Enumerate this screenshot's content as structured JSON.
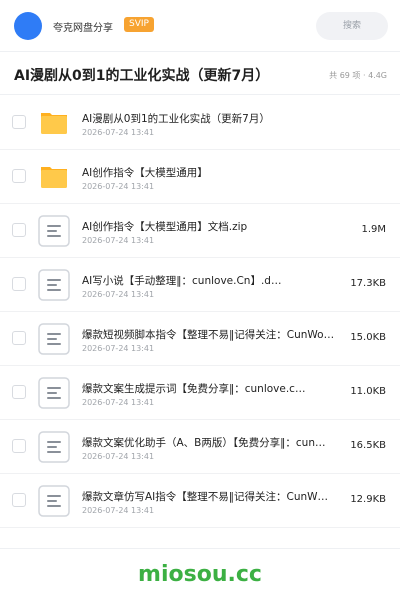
{
  "header": {
    "user_name": "夸克网盘分享",
    "badge": "SVIP",
    "search_placeholder": "搜索"
  },
  "folder": {
    "title": "AI漫剧从0到1的工业化实战（更新7月）",
    "meta": "共 69 项 · 4.4G"
  },
  "files": [
    {
      "type": "folder",
      "icon": "folder-icon",
      "name": "AI漫剧从0到1的工业化实战（更新7月）",
      "date": "2026-07-24 13:41",
      "size": ""
    },
    {
      "type": "folder",
      "icon": "folder-icon",
      "name": "AI创作指令【大模型通用】",
      "date": "2026-07-24 13:41",
      "size": ""
    },
    {
      "type": "file",
      "icon": "document-icon",
      "name": "AI创作指令【大模型通用】文档.zip",
      "date": "2026-07-24 13:41",
      "size": "1.9M"
    },
    {
      "type": "file",
      "icon": "document-icon",
      "name": "AI写小说【手动整理‖：cunlove.Cn】.d…",
      "date": "2026-07-24 13:41",
      "size": "17.3KB"
    },
    {
      "type": "file",
      "icon": "document-icon",
      "name": "爆款短视频脚本指令【整理不易‖记得关注：CunWo…",
      "date": "2026-07-24 13:41",
      "size": "15.0KB"
    },
    {
      "type": "file",
      "icon": "document-icon",
      "name": "爆款文案生成提示词【免费分享‖：cunlove.c…",
      "date": "2026-07-24 13:41",
      "size": "11.0KB"
    },
    {
      "type": "file",
      "icon": "document-icon",
      "name": "爆款文案优化助手（A、B两版）【免费分享‖：cun…",
      "date": "2026-07-24 13:41",
      "size": "16.5KB"
    },
    {
      "type": "file",
      "icon": "document-icon",
      "name": "爆款文章仿写AI指令【整理不易‖记得关注：CunW…",
      "date": "2026-07-24 13:41",
      "size": "12.9KB"
    }
  ],
  "watermark": "miosou.cc",
  "colors": {
    "accent": "#2f7cf6",
    "svip": "#f7a331",
    "folder": "#ffc22e",
    "watermark": "#3cb043"
  }
}
